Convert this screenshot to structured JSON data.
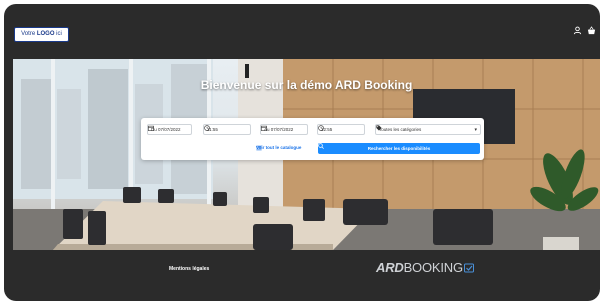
{
  "header": {
    "logo_prefix": "Votre",
    "logo_bold": "LOGO",
    "logo_suffix": "ici",
    "icons": [
      "user-icon",
      "basket-icon"
    ]
  },
  "hero": {
    "title": "Bienvenue sur la démo ARD Booking"
  },
  "search": {
    "start_date": "Du 07/07/2022",
    "start_time": "11:55",
    "end_date": "Au 07/07/2022",
    "end_time": "12:55",
    "category": "Toutes les catégories",
    "catalog_link": "Voir tout le catalogue",
    "search_button": "Rechercher les disponibilités"
  },
  "footer": {
    "legal": "Mentions légales",
    "brand_bold": "ARD",
    "brand_light": "BOOKING"
  },
  "colors": {
    "frame": "#2b2b2b",
    "accent": "#1a8cff",
    "link": "#1a73e8"
  }
}
